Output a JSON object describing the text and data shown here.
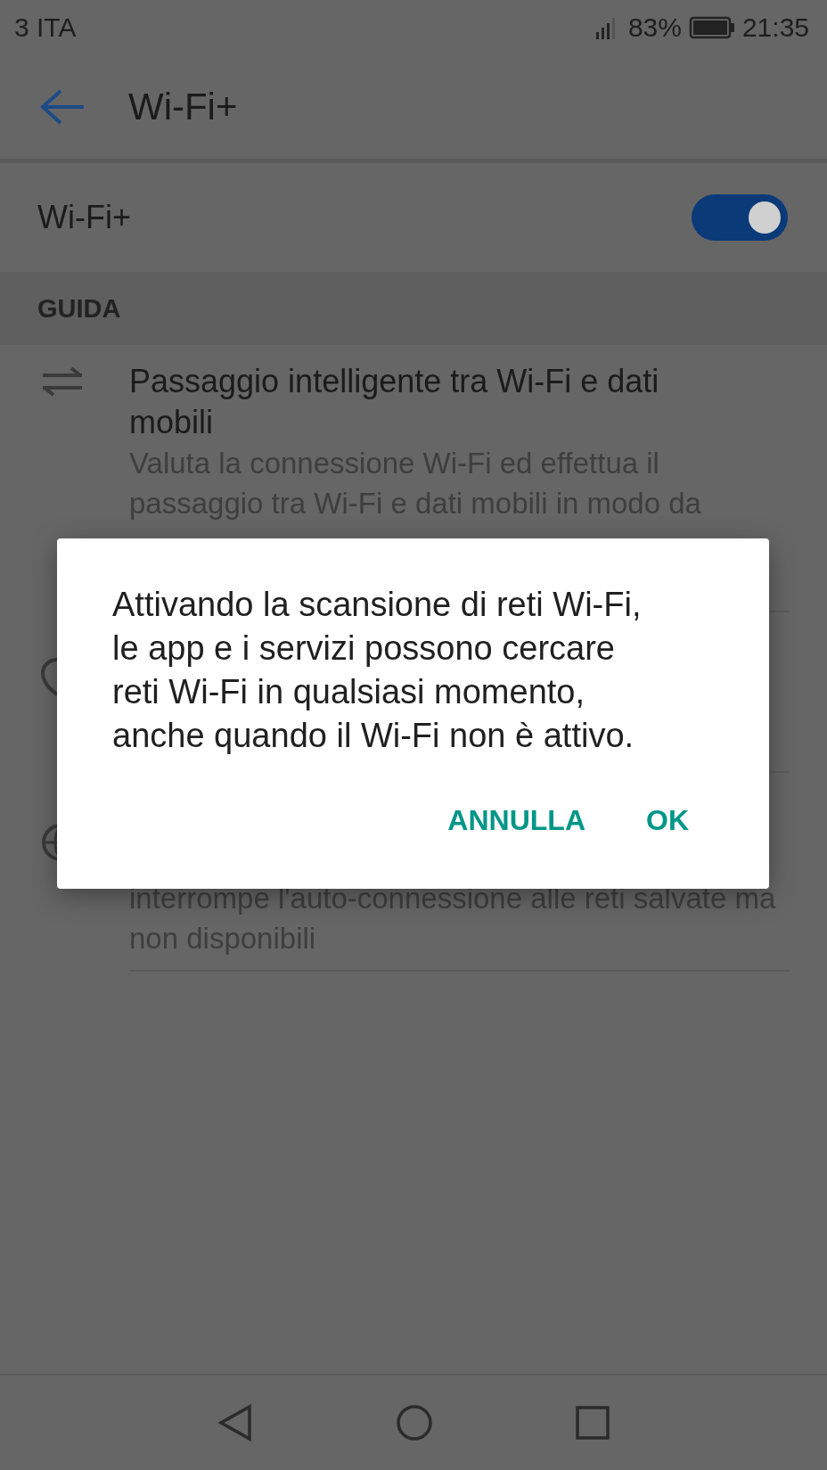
{
  "status_bar": {
    "carrier": "3 ITA",
    "battery": "83%",
    "time": "21:35"
  },
  "toolbar": {
    "title": "Wi-Fi+"
  },
  "master_switch": {
    "label": "Wi-Fi+",
    "on": true
  },
  "section": {
    "title": "GUIDA"
  },
  "items": [
    {
      "kind": "swap",
      "title": "Passaggio intelligente tra Wi-Fi e dati mobili",
      "description": [
        "Valuta la connessione Wi-Fi ed effettua il",
        "passaggio tra Wi-Fi e dati mobili in modo da"
      ]
    },
    {
      "kind": "shield"
    },
    {
      "kind": "globe",
      "description": [
        "interrompe l'auto-connessione alle reti salvate ma",
        "non disponibili"
      ]
    }
  ],
  "dialog": {
    "message": "Attivando la scansione di reti Wi-Fi, le app e i servizi possono cercare reti Wi-Fi in qualsiasi momento, anche quando il Wi-Fi non è attivo.",
    "buttons": [
      "ANNULLA",
      "OK"
    ]
  }
}
